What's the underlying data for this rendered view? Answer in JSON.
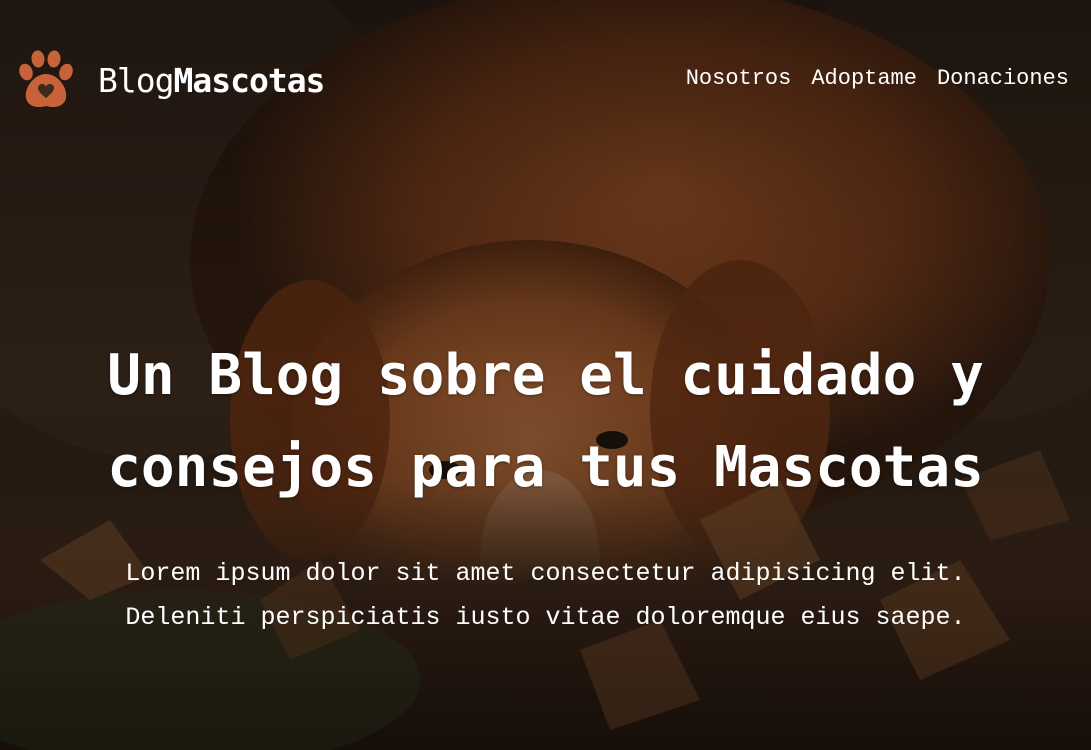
{
  "brand": {
    "name_light": "Blog",
    "name_bold": "Mascotas",
    "logo_icon": "paw-heart-icon",
    "logo_color": "#c8623a"
  },
  "nav": {
    "items": [
      {
        "label": "Nosotros"
      },
      {
        "label": "Adoptame"
      },
      {
        "label": "Donaciones"
      }
    ]
  },
  "hero": {
    "title_line1": "Un Blog sobre el cuidado y",
    "title_line2": "consejos para tus Mascotas",
    "lead_line1": "Lorem ipsum dolor sit amet consectetur adipisicing elit.",
    "lead_line2": "Deleniti perspiciatis iusto vitae doloremque eius saepe.",
    "background_image": "dog-in-autumn-leaves"
  },
  "colors": {
    "text": "#ffffff",
    "accent": "#c8623a",
    "overlay": "#000000"
  }
}
